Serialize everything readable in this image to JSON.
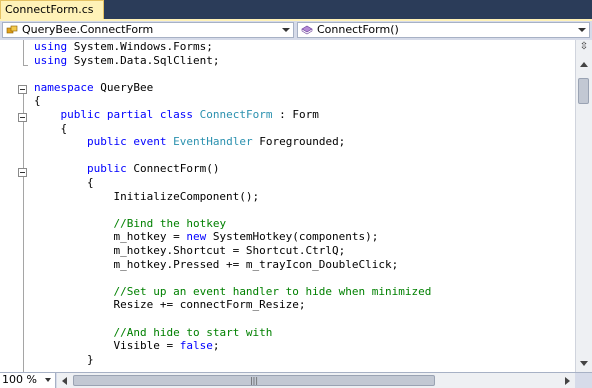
{
  "tab": {
    "label": "ConnectForm.cs"
  },
  "navbar": {
    "type_combo": "QueryBee.ConnectForm",
    "member_combo": "ConnectForm()"
  },
  "code_lines": [
    {
      "parts": [
        {
          "t": "using",
          "c": "kw"
        },
        {
          "t": " System.Windows.Forms;",
          "c": ""
        }
      ]
    },
    {
      "parts": [
        {
          "t": "using",
          "c": "kw"
        },
        {
          "t": " System.Data.SqlClient;",
          "c": ""
        }
      ]
    },
    {
      "parts": [
        {
          "t": "",
          "c": ""
        }
      ]
    },
    {
      "parts": [
        {
          "t": "namespace",
          "c": "kw"
        },
        {
          "t": " QueryBee",
          "c": ""
        }
      ]
    },
    {
      "parts": [
        {
          "t": "{",
          "c": ""
        }
      ]
    },
    {
      "parts": [
        {
          "t": "    ",
          "c": ""
        },
        {
          "t": "public",
          "c": "kw"
        },
        {
          "t": " ",
          "c": ""
        },
        {
          "t": "partial",
          "c": "kw"
        },
        {
          "t": " ",
          "c": ""
        },
        {
          "t": "class",
          "c": "kw"
        },
        {
          "t": " ",
          "c": ""
        },
        {
          "t": "ConnectForm",
          "c": "ty"
        },
        {
          "t": " : Form",
          "c": ""
        }
      ]
    },
    {
      "parts": [
        {
          "t": "    {",
          "c": ""
        }
      ]
    },
    {
      "parts": [
        {
          "t": "        ",
          "c": ""
        },
        {
          "t": "public",
          "c": "kw"
        },
        {
          "t": " ",
          "c": ""
        },
        {
          "t": "event",
          "c": "kw"
        },
        {
          "t": " ",
          "c": ""
        },
        {
          "t": "EventHandler",
          "c": "ty"
        },
        {
          "t": " Foregrounded;",
          "c": ""
        }
      ]
    },
    {
      "parts": [
        {
          "t": "",
          "c": ""
        }
      ]
    },
    {
      "parts": [
        {
          "t": "        ",
          "c": ""
        },
        {
          "t": "public",
          "c": "kw"
        },
        {
          "t": " ConnectForm()",
          "c": ""
        }
      ]
    },
    {
      "parts": [
        {
          "t": "        {",
          "c": ""
        }
      ]
    },
    {
      "parts": [
        {
          "t": "            InitializeComponent();",
          "c": ""
        }
      ]
    },
    {
      "parts": [
        {
          "t": "",
          "c": ""
        }
      ]
    },
    {
      "parts": [
        {
          "t": "            ",
          "c": ""
        },
        {
          "t": "//Bind the hotkey",
          "c": "cm"
        }
      ]
    },
    {
      "parts": [
        {
          "t": "            m_hotkey = ",
          "c": ""
        },
        {
          "t": "new",
          "c": "kw"
        },
        {
          "t": " SystemHotkey(components);",
          "c": ""
        }
      ]
    },
    {
      "parts": [
        {
          "t": "            m_hotkey.Shortcut = Shortcut.CtrlQ;",
          "c": ""
        }
      ]
    },
    {
      "parts": [
        {
          "t": "            m_hotkey.Pressed += m_trayIcon_DoubleClick;",
          "c": ""
        }
      ]
    },
    {
      "parts": [
        {
          "t": "",
          "c": ""
        }
      ]
    },
    {
      "parts": [
        {
          "t": "            ",
          "c": ""
        },
        {
          "t": "//Set up an event handler to hide when minimized",
          "c": "cm"
        }
      ]
    },
    {
      "parts": [
        {
          "t": "            Resize += connectForm_Resize;",
          "c": ""
        }
      ]
    },
    {
      "parts": [
        {
          "t": "",
          "c": ""
        }
      ]
    },
    {
      "parts": [
        {
          "t": "            ",
          "c": ""
        },
        {
          "t": "//And hide to start with",
          "c": "cm"
        }
      ]
    },
    {
      "parts": [
        {
          "t": "            Visible = ",
          "c": ""
        },
        {
          "t": "false",
          "c": "kw"
        },
        {
          "t": ";",
          "c": ""
        }
      ]
    },
    {
      "parts": [
        {
          "t": "        }",
          "c": ""
        }
      ]
    }
  ],
  "zoom": {
    "value": "100 %"
  },
  "colors": {
    "keyword": "#0000ff",
    "type": "#2b91af",
    "comment": "#008000",
    "tab_bg": "#fff2b8",
    "strip_bg": "#2b3c59"
  }
}
